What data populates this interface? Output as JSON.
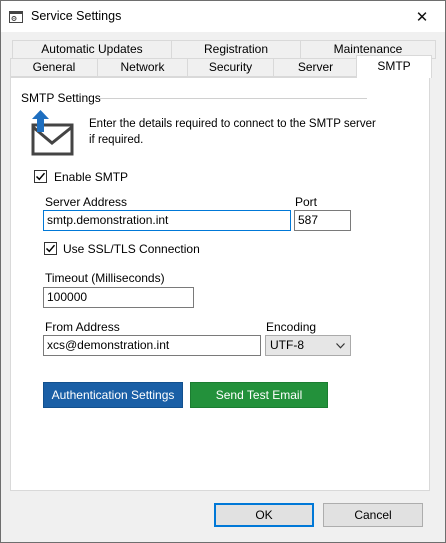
{
  "window": {
    "title": "Service Settings",
    "close_glyph": "✕"
  },
  "tabs": {
    "row_top": [
      "Automatic Updates",
      "Registration",
      "Maintenance"
    ],
    "row_bottom": [
      "General",
      "Network",
      "Security",
      "Server",
      "SMTP"
    ],
    "active": "SMTP"
  },
  "smtp": {
    "group_label": "SMTP Settings",
    "description_line1": "Enter the details required to connect to the SMTP server",
    "description_line2": "if required.",
    "enable_label": "Enable SMTP",
    "enable_checked": true,
    "server_address_label": "Server Address",
    "server_address_value": "smtp.demonstration.int",
    "port_label": "Port",
    "port_value": "587",
    "ssl_label": "Use SSL/TLS Connection",
    "ssl_checked": true,
    "timeout_label": "Timeout (Milliseconds)",
    "timeout_value": "100000",
    "from_address_label": "From Address",
    "from_address_value": "xcs@demonstration.int",
    "encoding_label": "Encoding",
    "encoding_value": "UTF-8",
    "auth_button": "Authentication Settings",
    "test_email_button": "Send Test Email"
  },
  "dialog": {
    "ok": "OK",
    "cancel": "Cancel"
  },
  "colors": {
    "auth_button": "#1a5fa6",
    "test_button": "#23913b",
    "focus_border": "#0078d7",
    "icon_blue": "#1e6fc0"
  }
}
